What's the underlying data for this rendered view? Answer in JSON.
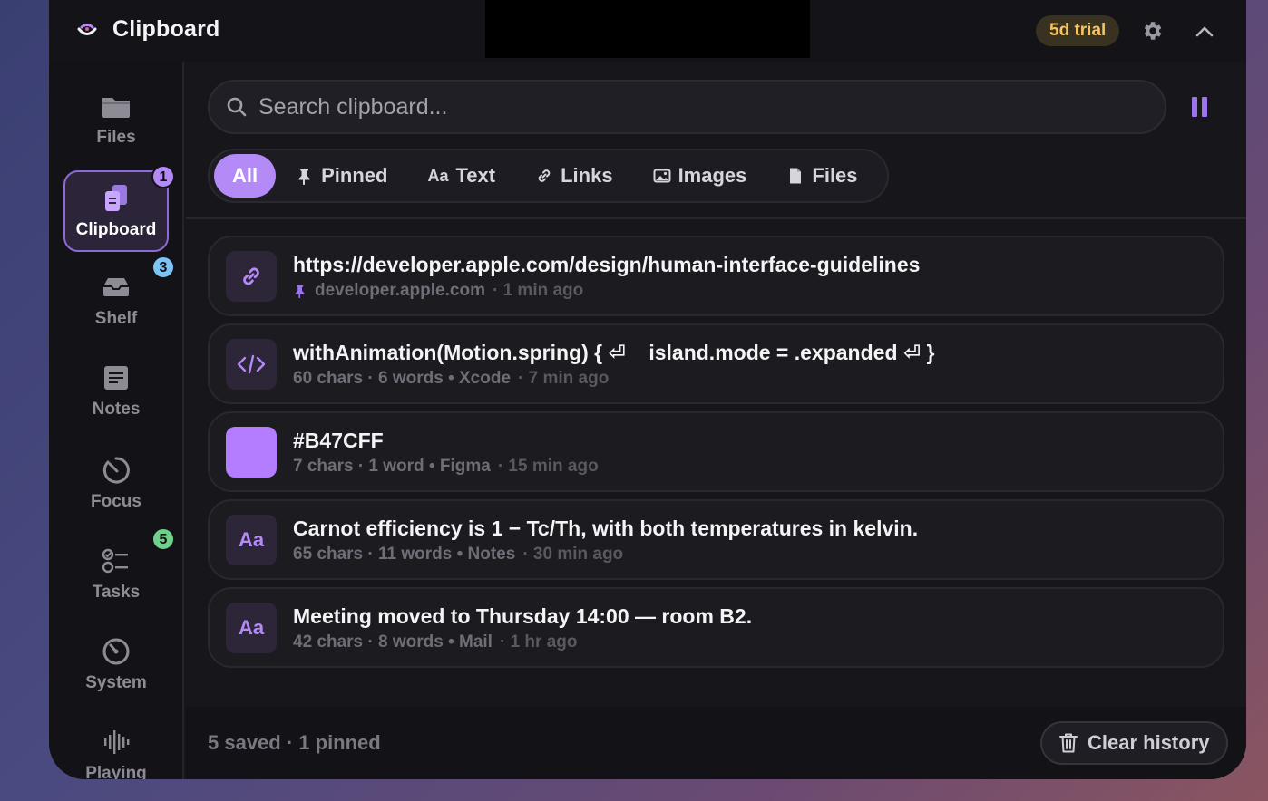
{
  "app": {
    "title": "Clipboard",
    "trial_label": "5d trial"
  },
  "sidebar": {
    "items": [
      {
        "label": "Files",
        "icon": "folder-icon"
      },
      {
        "label": "Clipboard",
        "icon": "clipboard-icon",
        "badge": "1",
        "active": true
      },
      {
        "label": "Shelf",
        "icon": "tray-icon",
        "badge": "3"
      },
      {
        "label": "Notes",
        "icon": "note-icon"
      },
      {
        "label": "Focus",
        "icon": "timer-icon"
      },
      {
        "label": "Tasks",
        "icon": "checklist-icon",
        "badge": "5"
      },
      {
        "label": "System",
        "icon": "gauge-icon"
      },
      {
        "label": "Playing",
        "icon": "waveform-icon"
      }
    ]
  },
  "search": {
    "placeholder": "Search clipboard..."
  },
  "filters": [
    {
      "label": "All",
      "active": true
    },
    {
      "label": "Pinned",
      "icon": "pin-icon"
    },
    {
      "label": "Text",
      "icon": "text-icon",
      "icon_text": "Aa"
    },
    {
      "label": "Links",
      "icon": "link-icon"
    },
    {
      "label": "Images",
      "icon": "image-icon"
    },
    {
      "label": "Files",
      "icon": "file-icon"
    }
  ],
  "clips": [
    {
      "type": "link",
      "title": "https://developer.apple.com/design/human-interface-guidelines",
      "pinned": true,
      "meta_primary": "developer.apple.com",
      "time": "· 1 min ago"
    },
    {
      "type": "code",
      "title": "withAnimation(Motion.spring) { ⏎    island.mode = .expanded ⏎ }",
      "meta_primary": "60 chars · 6 words • Xcode",
      "time": "· 7 min ago"
    },
    {
      "type": "color",
      "swatch": "#B47CFF",
      "title": "#B47CFF",
      "meta_primary": "7 chars · 1 word • Figma",
      "time": "· 15 min ago"
    },
    {
      "type": "text",
      "thumb_text": "Aa",
      "title": "Carnot efficiency is 1 − Tc/Th, with both temperatures in kelvin.",
      "meta_primary": "65 chars · 11 words • Notes",
      "time": "· 30 min ago"
    },
    {
      "type": "text",
      "thumb_text": "Aa",
      "title": "Meeting moved to Thursday 14:00 — room B2.",
      "meta_primary": "42 chars · 8 words • Mail",
      "time": "· 1 hr ago"
    }
  ],
  "footer": {
    "stats": "5 saved · 1 pinned",
    "clear_label": "Clear history"
  },
  "colors": {
    "accent": "#B48AF7",
    "badge_purple": "#B48AF7",
    "badge_blue": "#7CC4F5",
    "badge_green": "#6FD08C",
    "trial": "#F3C45F"
  }
}
